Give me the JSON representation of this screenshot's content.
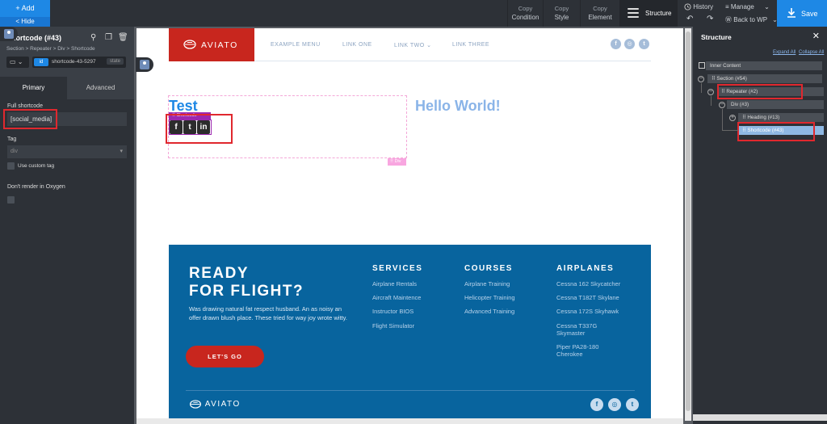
{
  "toolbar": {
    "add_label": "+ Add",
    "hide_label": "< Hide",
    "copy_condition": [
      "Copy",
      "Condition"
    ],
    "copy_style": [
      "Copy",
      "Style"
    ],
    "copy_element": [
      "Copy",
      "Element"
    ],
    "structure_label": "Structure",
    "history_label": "History",
    "manage_label": "Manage",
    "back_to_wp_label": "Back to WP",
    "save_label": "Save"
  },
  "left_panel": {
    "title": "Shortcode (#43)",
    "breadcrumb": "Section > Repeater > Div > Shortcode",
    "id_badge": "id",
    "element_id": "shortcode-43-5297",
    "state_label": "state",
    "tabs": [
      "Primary",
      "Advanced"
    ],
    "full_shortcode_label": "Full shortcode",
    "full_shortcode_value": "[social_media]",
    "tag_label": "Tag",
    "tag_value": "div",
    "custom_tag_label": "Use custom tag",
    "dont_render_label": "Don't render in Oxygen"
  },
  "site": {
    "logo_text": "AVIATO",
    "menu": [
      "EXAMPLE MENU",
      "LINK ONE",
      "LINK TWO",
      "LINK THREE"
    ],
    "social_icons": [
      "facebook-icon",
      "instagram-icon",
      "twitter-icon"
    ],
    "test_heading": "Test",
    "hello_heading": "Hello World!",
    "shortcode_tag": "Shortcode",
    "div_tag": "Div",
    "social_media_icons": [
      "facebook-square-icon",
      "twitter-square-icon",
      "linkedin-square-icon"
    ]
  },
  "footer": {
    "heading_line1": "READY",
    "heading_line2": "FOR FLIGHT?",
    "paragraph": "Was drawing natural fat respect husband. An as noisy an offer drawn blush place. These tried for way joy wrote witty.",
    "button_label": "LET'S GO",
    "columns": [
      {
        "title": "SERVICES",
        "items": [
          "Airplane Rentals",
          "Aircraft Maintence",
          "Instructor BIOS",
          "Flight Simulator"
        ]
      },
      {
        "title": "COURSES",
        "items": [
          "Airplane Training",
          "Helicopter Training",
          "Advanced Training"
        ]
      },
      {
        "title": "AIRPLANES",
        "items": [
          "Cessna 162 Skycatcher",
          "Cessna T182T Skylane",
          "Cessna 172S Skyhawk",
          "Cessna T337G Skymaster",
          "Piper PA28-180 Cherokee"
        ]
      }
    ],
    "logo_text": "AVIATO"
  },
  "structure": {
    "title": "Structure",
    "expand_all": "Expand All",
    "collapse_all": "Collapse All",
    "nodes": [
      "Inner Content",
      "Section (#54)",
      "Repeater (#2)",
      "Div (#3)",
      "Heading (#13)",
      "Shortcode (#43)"
    ]
  },
  "colors": {
    "accent": "#1e88e5",
    "brand_red": "#c8261e",
    "footer_blue": "#08649e",
    "highlight_red": "#e0282e",
    "selected_node": "#8fb8e3"
  }
}
